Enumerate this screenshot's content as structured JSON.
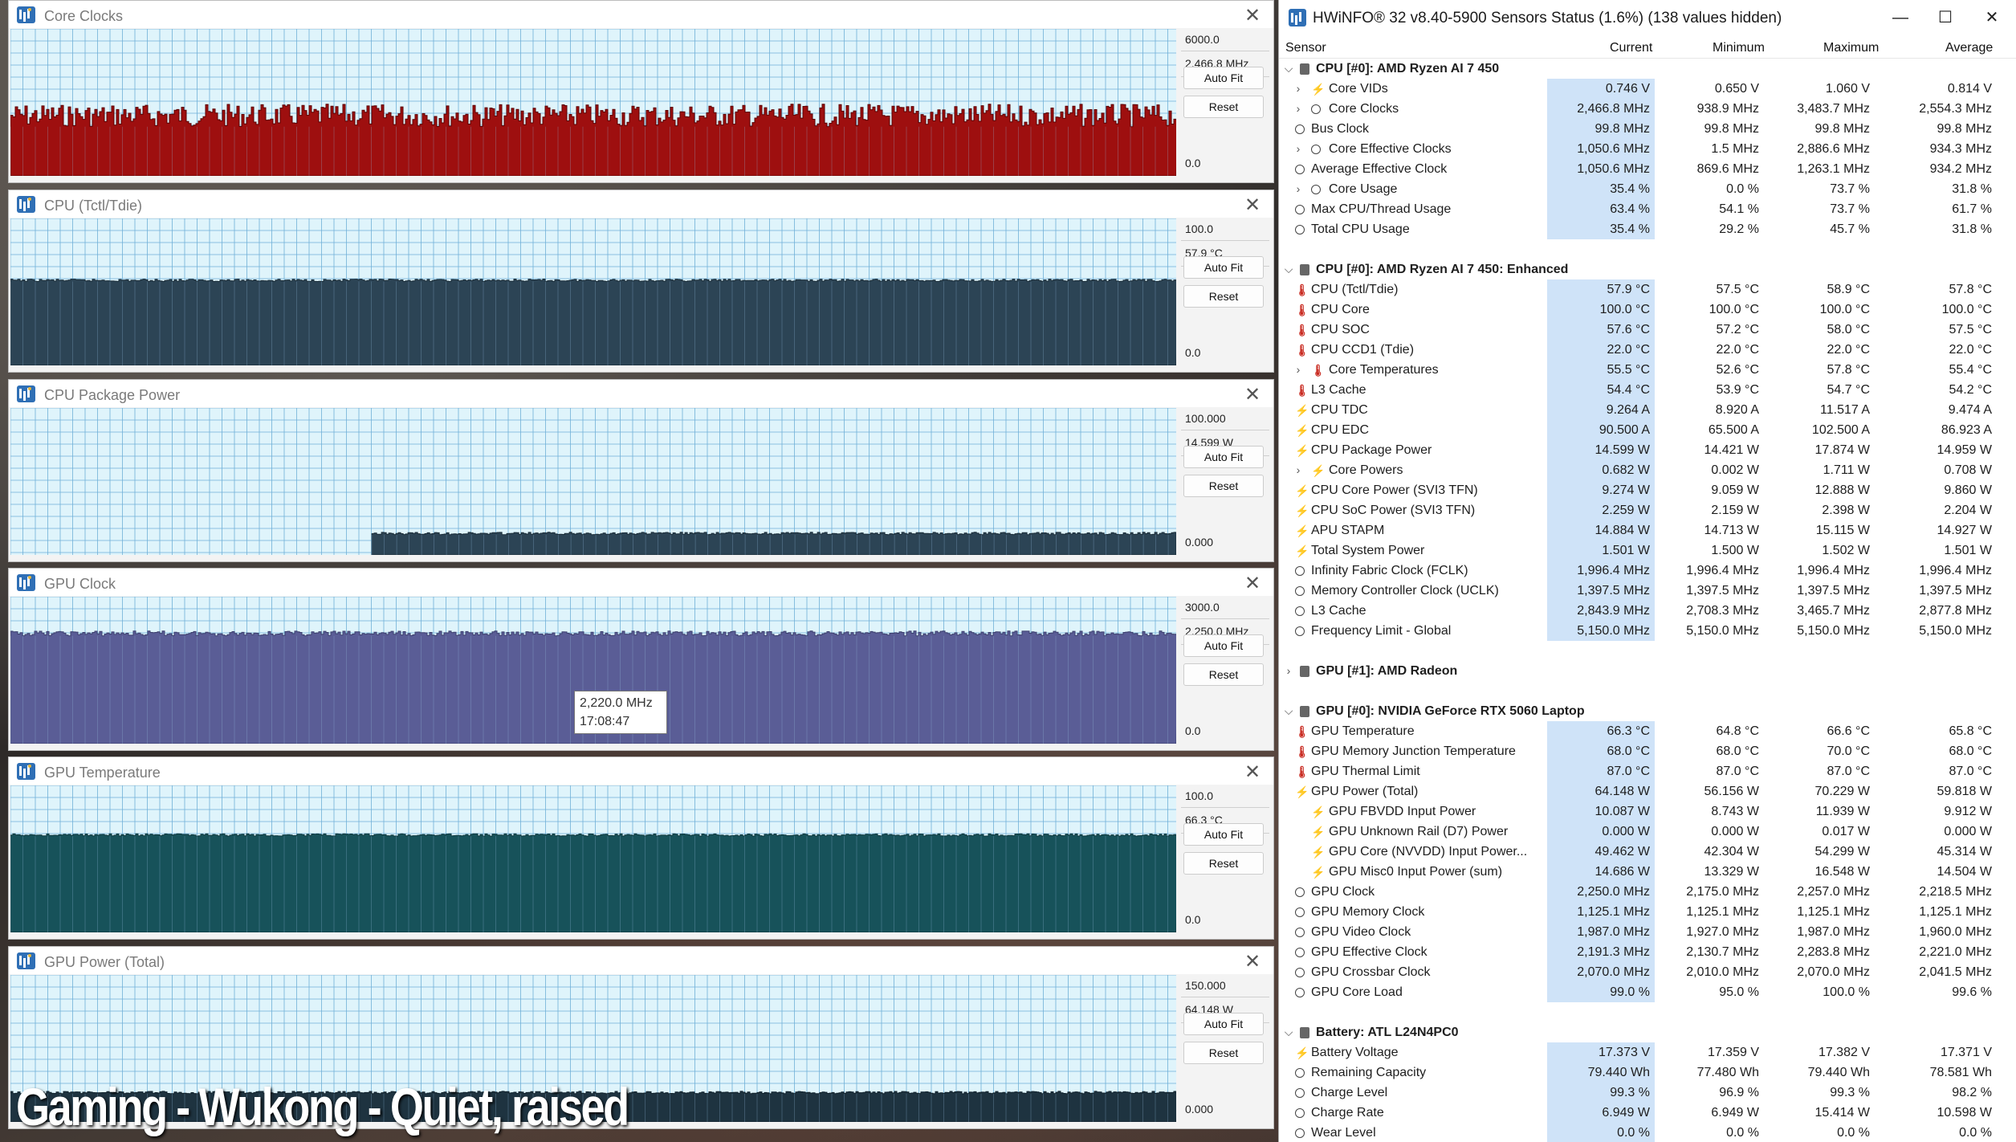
{
  "graph_windows": [
    {
      "title": "Core Clocks",
      "ymax": "6000.0",
      "current": "2,466.8 MHz",
      "ymin": "0.0",
      "auto_fit": "Auto Fit",
      "reset": "Reset",
      "chart_data": {
        "type": "area",
        "ylim": [
          0,
          6000
        ],
        "level": 2466.8,
        "fill": "#9e0f0f",
        "line": "#5a0000"
      }
    },
    {
      "title": "CPU (Tctl/Tdie)",
      "ymax": "100.0",
      "current": "57.9 °C",
      "ymin": "0.0",
      "auto_fit": "Auto Fit",
      "reset": "Reset",
      "chart_data": {
        "type": "area",
        "ylim": [
          0,
          100
        ],
        "level": 57.9,
        "fill": "#2c4455",
        "line": "#1a2c38"
      }
    },
    {
      "title": "CPU Package Power",
      "ymax": "100.000",
      "current": "14.599 W",
      "ymin": "0.000",
      "auto_fit": "Auto Fit",
      "reset": "Reset",
      "chart_data": {
        "type": "area",
        "ylim": [
          0,
          100
        ],
        "level": 14.599,
        "start_fraction": 0.31,
        "fill": "#2c4455",
        "line": "#1a2c38"
      }
    },
    {
      "title": "GPU Clock",
      "ymax": "3000.0",
      "current": "2,250.0 MHz",
      "ymin": "0.0",
      "auto_fit": "Auto Fit",
      "reset": "Reset",
      "chart_data": {
        "type": "area",
        "ylim": [
          0,
          3000
        ],
        "level": 2250.0,
        "fill": "#5a5d96",
        "line": "#3c3f6e"
      }
    },
    {
      "title": "GPU Temperature",
      "ymax": "100.0",
      "current": "66.3 °C",
      "ymin": "0.0",
      "auto_fit": "Auto Fit",
      "reset": "Reset",
      "chart_data": {
        "type": "area",
        "ylim": [
          0,
          100
        ],
        "level": 66.3,
        "fill": "#17525a",
        "line": "#0e383e"
      }
    },
    {
      "title": "GPU Power (Total)",
      "ymax": "150.000",
      "current": "64.148 W",
      "ymin": "0.000",
      "auto_fit": "Auto Fit",
      "reset": "Reset",
      "chart_data": {
        "type": "area",
        "ylim": [
          0,
          150
        ],
        "level": 30,
        "fill": "#1e3340",
        "line": "#10222c"
      }
    }
  ],
  "tooltip": {
    "value": "2,220.0 MHz",
    "time": "17:08:47"
  },
  "caption": "Gaming - Wukong - Quiet, raised",
  "sensor_window": {
    "title": "HWiNFO® 32 v8.40-5900 Sensors Status (1.6%) (138 values hidden)",
    "controls": {
      "minimize": "—",
      "maximize": "☐",
      "close": "✕"
    },
    "columns": [
      "Sensor",
      "Current",
      "Minimum",
      "Maximum",
      "Average"
    ],
    "rows": [
      {
        "type": "group",
        "label": "CPU [#0]: AMD Ryzen AI 7 450",
        "expanded": true
      },
      {
        "level": 1,
        "exp": true,
        "icon": "bolt",
        "label": "Core VIDs",
        "v": [
          "0.746 V",
          "0.650 V",
          "1.060 V",
          "0.814 V"
        ]
      },
      {
        "level": 1,
        "exp": true,
        "icon": "clock",
        "label": "Core Clocks",
        "v": [
          "2,466.8 MHz",
          "938.9 MHz",
          "3,483.7 MHz",
          "2,554.3 MHz"
        ]
      },
      {
        "level": 0,
        "icon": "clock",
        "label": "Bus Clock",
        "v": [
          "99.8 MHz",
          "99.8 MHz",
          "99.8 MHz",
          "99.8 MHz"
        ]
      },
      {
        "level": 1,
        "exp": true,
        "icon": "clock",
        "label": "Core Effective Clocks",
        "v": [
          "1,050.6 MHz",
          "1.5 MHz",
          "2,886.6 MHz",
          "934.3 MHz"
        ]
      },
      {
        "level": 0,
        "icon": "clock",
        "label": "Average Effective Clock",
        "v": [
          "1,050.6 MHz",
          "869.6 MHz",
          "1,263.1 MHz",
          "934.2 MHz"
        ]
      },
      {
        "level": 1,
        "exp": true,
        "icon": "clock",
        "label": "Core Usage",
        "v": [
          "35.4 %",
          "0.0 %",
          "73.7 %",
          "31.8 %"
        ]
      },
      {
        "level": 0,
        "icon": "clock",
        "label": "Max CPU/Thread Usage",
        "v": [
          "63.4 %",
          "54.1 %",
          "73.7 %",
          "61.7 %"
        ]
      },
      {
        "level": 0,
        "icon": "clock",
        "label": "Total CPU Usage",
        "v": [
          "35.4 %",
          "29.2 %",
          "45.7 %",
          "31.8 %"
        ]
      },
      {
        "type": "spacer"
      },
      {
        "type": "group",
        "label": "CPU [#0]: AMD Ryzen AI 7 450: Enhanced",
        "expanded": true
      },
      {
        "level": 0,
        "icon": "therm",
        "label": "CPU (Tctl/Tdie)",
        "v": [
          "57.9 °C",
          "57.5 °C",
          "58.9 °C",
          "57.8 °C"
        ]
      },
      {
        "level": 0,
        "icon": "therm",
        "label": "CPU Core",
        "v": [
          "100.0 °C",
          "100.0 °C",
          "100.0 °C",
          "100.0 °C"
        ]
      },
      {
        "level": 0,
        "icon": "therm",
        "label": "CPU SOC",
        "v": [
          "57.6 °C",
          "57.2 °C",
          "58.0 °C",
          "57.5 °C"
        ]
      },
      {
        "level": 0,
        "icon": "therm",
        "label": "CPU CCD1 (Tdie)",
        "v": [
          "22.0 °C",
          "22.0 °C",
          "22.0 °C",
          "22.0 °C"
        ]
      },
      {
        "level": 1,
        "exp": true,
        "icon": "therm",
        "label": "Core Temperatures",
        "v": [
          "55.5 °C",
          "52.6 °C",
          "57.8 °C",
          "55.4 °C"
        ]
      },
      {
        "level": 0,
        "icon": "therm",
        "label": "L3 Cache",
        "v": [
          "54.4 °C",
          "53.9 °C",
          "54.7 °C",
          "54.2 °C"
        ]
      },
      {
        "level": 0,
        "icon": "bolt",
        "label": "CPU TDC",
        "v": [
          "9.264 A",
          "8.920 A",
          "11.517 A",
          "9.474 A"
        ]
      },
      {
        "level": 0,
        "icon": "bolt",
        "label": "CPU EDC",
        "v": [
          "90.500 A",
          "65.500 A",
          "102.500 A",
          "86.923 A"
        ]
      },
      {
        "level": 0,
        "icon": "bolt",
        "label": "CPU Package Power",
        "v": [
          "14.599 W",
          "14.421 W",
          "17.874 W",
          "14.959 W"
        ]
      },
      {
        "level": 1,
        "exp": true,
        "icon": "bolt",
        "label": "Core Powers",
        "v": [
          "0.682 W",
          "0.002 W",
          "1.711 W",
          "0.708 W"
        ]
      },
      {
        "level": 0,
        "icon": "bolt",
        "label": "CPU Core Power (SVI3 TFN)",
        "v": [
          "9.274 W",
          "9.059 W",
          "12.888 W",
          "9.860 W"
        ]
      },
      {
        "level": 0,
        "icon": "bolt",
        "label": "CPU SoC Power (SVI3 TFN)",
        "v": [
          "2.259 W",
          "2.159 W",
          "2.398 W",
          "2.204 W"
        ]
      },
      {
        "level": 0,
        "icon": "bolt",
        "label": "APU STAPM",
        "v": [
          "14.884 W",
          "14.713 W",
          "15.115 W",
          "14.927 W"
        ]
      },
      {
        "level": 0,
        "icon": "bolt",
        "label": "Total System Power",
        "v": [
          "1.501 W",
          "1.500 W",
          "1.502 W",
          "1.501 W"
        ]
      },
      {
        "level": 0,
        "icon": "clock",
        "label": "Infinity Fabric Clock (FCLK)",
        "v": [
          "1,996.4 MHz",
          "1,996.4 MHz",
          "1,996.4 MHz",
          "1,996.4 MHz"
        ]
      },
      {
        "level": 0,
        "icon": "clock",
        "label": "Memory Controller Clock (UCLK)",
        "v": [
          "1,397.5 MHz",
          "1,397.5 MHz",
          "1,397.5 MHz",
          "1,397.5 MHz"
        ]
      },
      {
        "level": 0,
        "icon": "clock",
        "label": "L3 Cache",
        "v": [
          "2,843.9 MHz",
          "2,708.3 MHz",
          "3,465.7 MHz",
          "2,877.8 MHz"
        ]
      },
      {
        "level": 0,
        "icon": "clock",
        "label": "Frequency Limit - Global",
        "v": [
          "5,150.0 MHz",
          "5,150.0 MHz",
          "5,150.0 MHz",
          "5,150.0 MHz"
        ]
      },
      {
        "type": "spacer"
      },
      {
        "type": "group",
        "label": "GPU [#1]: AMD Radeon",
        "expanded": false
      },
      {
        "type": "spacer"
      },
      {
        "type": "group",
        "label": "GPU [#0]: NVIDIA GeForce RTX 5060 Laptop",
        "expanded": true
      },
      {
        "level": 0,
        "icon": "therm",
        "label": "GPU Temperature",
        "v": [
          "66.3 °C",
          "64.8 °C",
          "66.6 °C",
          "65.8 °C"
        ]
      },
      {
        "level": 0,
        "icon": "therm",
        "label": "GPU Memory Junction Temperature",
        "v": [
          "68.0 °C",
          "68.0 °C",
          "70.0 °C",
          "68.0 °C"
        ]
      },
      {
        "level": 0,
        "icon": "therm",
        "label": "GPU Thermal Limit",
        "v": [
          "87.0 °C",
          "87.0 °C",
          "87.0 °C",
          "87.0 °C"
        ]
      },
      {
        "level": 0,
        "icon": "bolt",
        "label": "GPU Power (Total)",
        "v": [
          "64.148 W",
          "56.156 W",
          "70.229 W",
          "59.818 W"
        ]
      },
      {
        "level": 2,
        "icon": "bolt",
        "label": "GPU FBVDD Input Power",
        "v": [
          "10.087 W",
          "8.743 W",
          "11.939 W",
          "9.912 W"
        ]
      },
      {
        "level": 2,
        "icon": "bolt",
        "label": "GPU Unknown Rail (D7) Power",
        "v": [
          "0.000 W",
          "0.000 W",
          "0.017 W",
          "0.000 W"
        ]
      },
      {
        "level": 2,
        "icon": "bolt",
        "label": "GPU Core (NVVDD) Input Power...",
        "v": [
          "49.462 W",
          "42.304 W",
          "54.299 W",
          "45.314 W"
        ]
      },
      {
        "level": 2,
        "icon": "bolt",
        "label": "GPU Misc0 Input Power (sum)",
        "v": [
          "14.686 W",
          "13.329 W",
          "16.548 W",
          "14.504 W"
        ]
      },
      {
        "level": 0,
        "icon": "clock",
        "label": "GPU Clock",
        "v": [
          "2,250.0 MHz",
          "2,175.0 MHz",
          "2,257.0 MHz",
          "2,218.5 MHz"
        ]
      },
      {
        "level": 0,
        "icon": "clock",
        "label": "GPU Memory Clock",
        "v": [
          "1,125.1 MHz",
          "1,125.1 MHz",
          "1,125.1 MHz",
          "1,125.1 MHz"
        ]
      },
      {
        "level": 0,
        "icon": "clock",
        "label": "GPU Video Clock",
        "v": [
          "1,987.0 MHz",
          "1,927.0 MHz",
          "1,987.0 MHz",
          "1,960.0 MHz"
        ]
      },
      {
        "level": 0,
        "icon": "clock",
        "label": "GPU Effective Clock",
        "v": [
          "2,191.3 MHz",
          "2,130.7 MHz",
          "2,283.8 MHz",
          "2,221.0 MHz"
        ]
      },
      {
        "level": 0,
        "icon": "clock",
        "label": "GPU Crossbar Clock",
        "v": [
          "2,070.0 MHz",
          "2,010.0 MHz",
          "2,070.0 MHz",
          "2,041.5 MHz"
        ]
      },
      {
        "level": 0,
        "icon": "clock",
        "label": "GPU Core Load",
        "v": [
          "99.0 %",
          "95.0 %",
          "100.0 %",
          "99.6 %"
        ]
      },
      {
        "type": "spacer"
      },
      {
        "type": "group",
        "label": "Battery: ATL L24N4PC0",
        "expanded": true
      },
      {
        "level": 0,
        "icon": "bolt",
        "label": "Battery Voltage",
        "v": [
          "17.373 V",
          "17.359 V",
          "17.382 V",
          "17.371 V"
        ]
      },
      {
        "level": 0,
        "icon": "clock",
        "label": "Remaining Capacity",
        "v": [
          "79.440 Wh",
          "77.480 Wh",
          "79.440 Wh",
          "78.581 Wh"
        ]
      },
      {
        "level": 0,
        "icon": "clock",
        "label": "Charge Level",
        "v": [
          "99.3 %",
          "96.9 %",
          "99.3 %",
          "98.2 %"
        ]
      },
      {
        "level": 0,
        "icon": "clock",
        "label": "Charge Rate",
        "v": [
          "6.949 W",
          "6.949 W",
          "15.414 W",
          "10.598 W"
        ]
      },
      {
        "level": 0,
        "icon": "clock",
        "label": "Wear Level",
        "v": [
          "0.0 %",
          "0.0 %",
          "0.0 %",
          "0.0 %"
        ]
      }
    ]
  }
}
